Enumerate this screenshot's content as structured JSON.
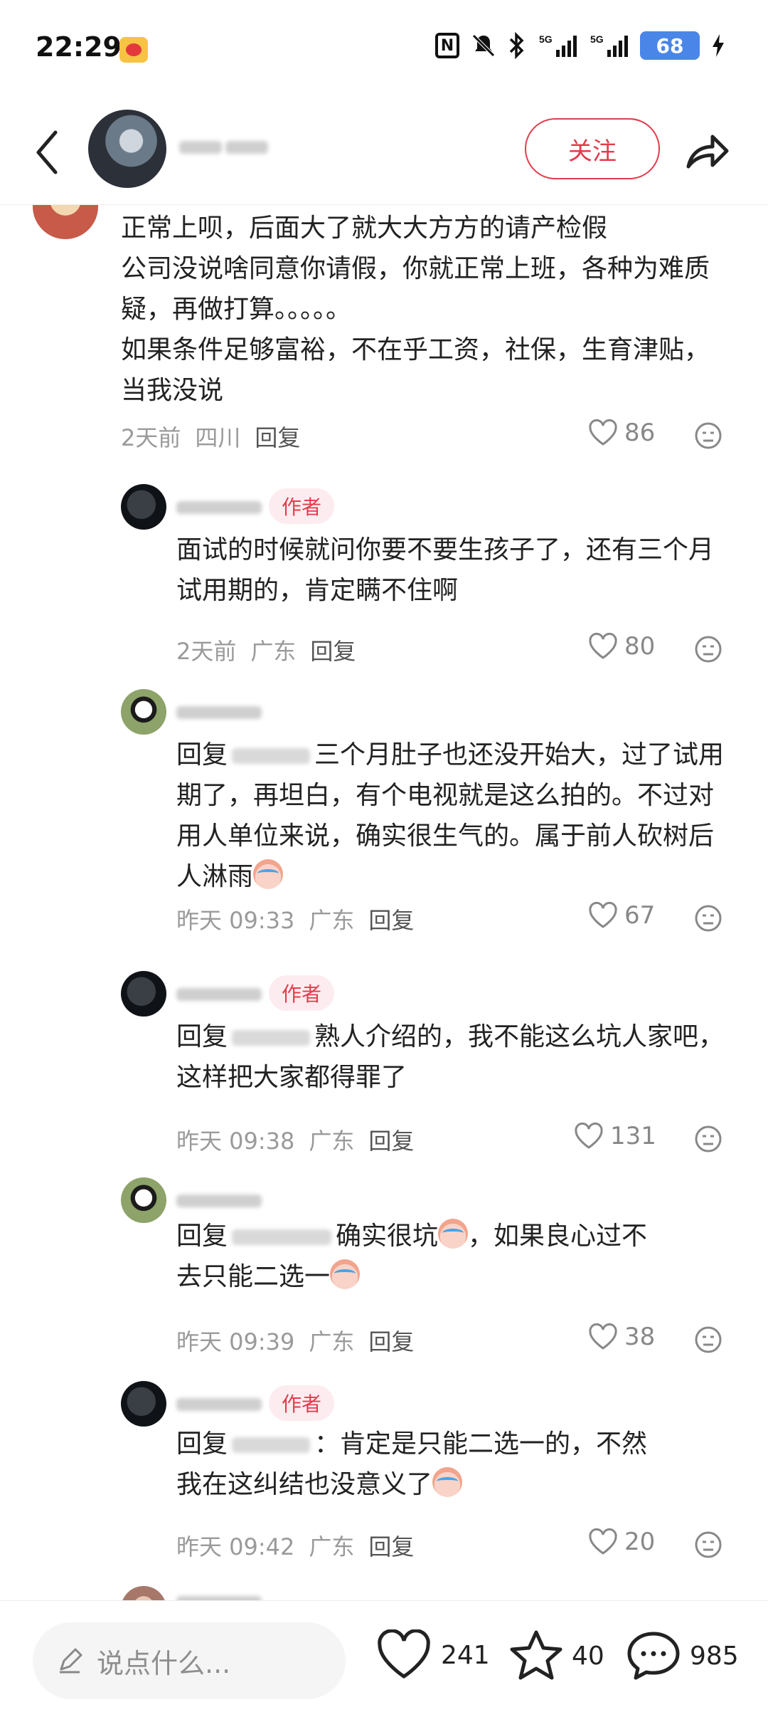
{
  "status_bar": {
    "time": "22:29",
    "battery": "68"
  },
  "header": {
    "follow_label": "关注"
  },
  "comments": [
    {
      "text": "正常上呗，后面大了就大大方方的请产检假\n公司没说啥同意你请假，你就正常上班，各种为难质疑，再做打算。。。。。\n如果条件足够富裕，不在乎工资，社保，生育津贴，当我没说",
      "time": "2天前",
      "location": "四川",
      "reply_label": "回复",
      "likes": "86"
    },
    {
      "badge": "作者",
      "text": "面试的时候就问你要不要生孩子了，还有三个月试用期的，肯定瞒不住啊",
      "time": "2天前",
      "location": "广东",
      "reply_label": "回复",
      "likes": "80"
    },
    {
      "reply_prefix": "回复",
      "text_a": "三个月肚子也还没开始大，",
      "text_b": "过了试用期了，再坦白，有个电视就是这么拍的。不过对用人单位来说，确实很生气的。属于前人砍树后人淋雨",
      "time": "昨天 09:33",
      "location": "广东",
      "reply_label": "回复",
      "likes": "67"
    },
    {
      "badge": "作者",
      "reply_prefix": "回复",
      "text_a": "熟人介绍的，我不能这么坑",
      "text_b": "人家吧，这样把大家都得罪了",
      "time": "昨天 09:38",
      "location": "广东",
      "reply_label": "回复",
      "likes": "131"
    },
    {
      "reply_prefix": "回复",
      "text_a": "确实很坑",
      "text_b": "，如果良心过不",
      "text_c": "去只能二选一",
      "time": "昨天 09:39",
      "location": "广东",
      "reply_label": "回复",
      "likes": "38"
    },
    {
      "badge": "作者",
      "reply_prefix": "回复",
      "text_a": "：肯定是只能二选一的，不然",
      "text_b": "我在这纠结也没意义了",
      "time": "昨天 09:42",
      "location": "广东",
      "reply_label": "回复",
      "likes": "20"
    }
  ],
  "bottom_bar": {
    "input_placeholder": "说点什么...",
    "likes": "241",
    "favorites": "40",
    "comments": "985"
  },
  "colors": {
    "accent": "#e23c4c",
    "battery": "#4a86e8"
  },
  "icons": [
    "back-icon",
    "share-icon",
    "heart-icon",
    "star-icon",
    "comment-icon",
    "emoji-icon",
    "pencil-icon"
  ]
}
